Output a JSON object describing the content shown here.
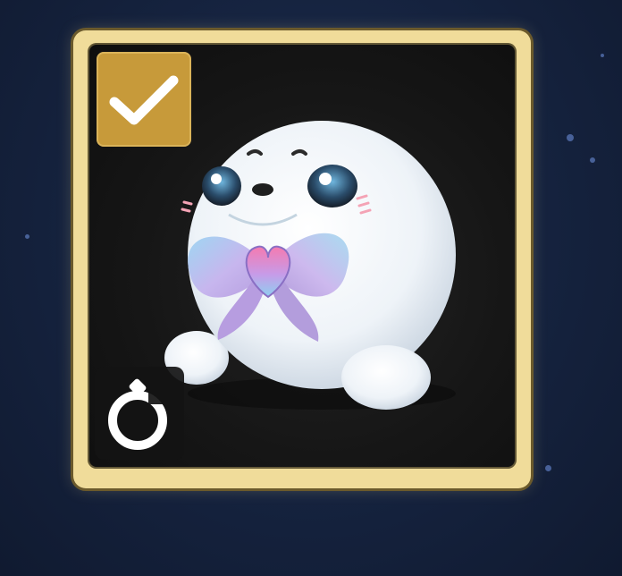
{
  "item": {
    "name": "",
    "selected": true,
    "icons": {
      "selection": "checkmark-icon",
      "duration": "timer-icon",
      "artwork": "white-seal-plush-with-heart-bow"
    }
  },
  "colors": {
    "background": "#14213a",
    "card_frame": "#f0dc9a",
    "card_inner": "#161616",
    "check_badge": "#c79a3a",
    "timer_badge": "#141414"
  }
}
